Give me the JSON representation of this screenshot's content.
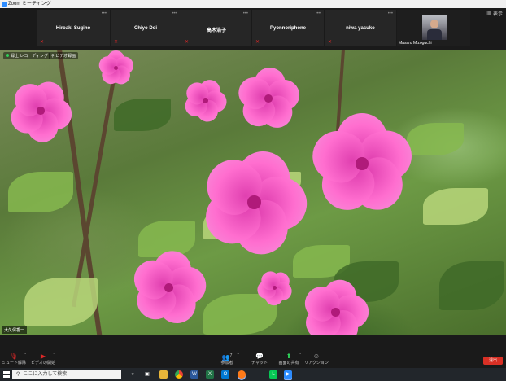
{
  "window": {
    "title": "Zoom ミーティング"
  },
  "participants": [
    {
      "name": "Hiroaki Sugino",
      "muted": true
    },
    {
      "name": "Chiyo Doi",
      "muted": true
    },
    {
      "name": "高木浩子",
      "muted": true
    },
    {
      "name": "Pyonnoriphone",
      "muted": true
    },
    {
      "name": "niwa yasuko",
      "muted": true
    },
    {
      "name": "Masaru Mizoguchi",
      "muted": false
    }
  ],
  "view_button": {
    "icon": "grid-icon",
    "label": "表示"
  },
  "video": {
    "status_badge": "緑上 レコーディング",
    "recording_badge": "ビデオ録画",
    "speaker": "大久保香一"
  },
  "toolbar": {
    "mute": {
      "icon": "microphone-icon",
      "label": "ミュート解除"
    },
    "video": {
      "icon": "video-camera-icon",
      "label": "ビデオの開始"
    },
    "participants": {
      "icon": "participants-icon",
      "label": "参加者",
      "count": "7"
    },
    "chat": {
      "icon": "chat-icon",
      "label": "チャット"
    },
    "share": {
      "icon": "share-screen-icon",
      "label": "画面の共有"
    },
    "reactions": {
      "icon": "reaction-icon",
      "label": "リアクション"
    },
    "end": {
      "label": "退出"
    }
  },
  "taskbar": {
    "search_placeholder": "ここに入力して検索",
    "apps": [
      "search-circle-icon",
      "task-view-icon",
      "file-explorer-icon",
      "chrome-icon",
      "word-icon",
      "excel-icon",
      "outlook-icon",
      "firefox-icon",
      "line-icon",
      "zoom-icon"
    ]
  },
  "colors": {
    "accent": "#2d8cff",
    "end_button": "#d93025",
    "muted_icon": "#e02828",
    "share_icon": "#2fd35a"
  }
}
